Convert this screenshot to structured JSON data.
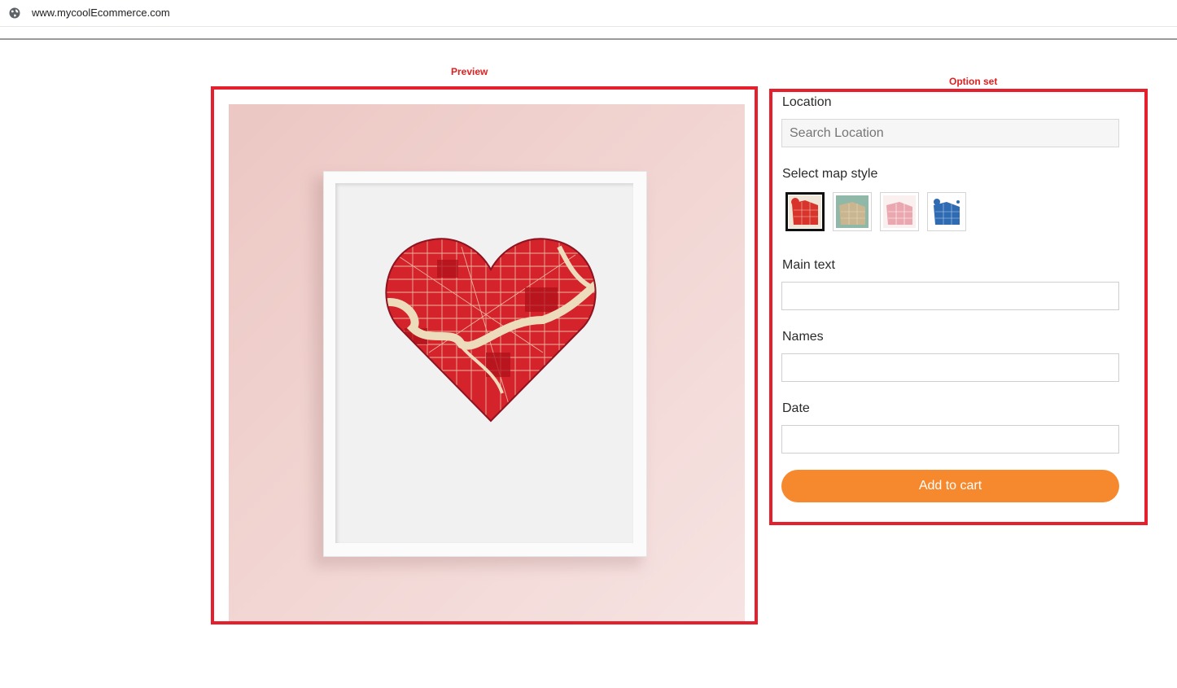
{
  "browser": {
    "url": "www.mycoolEcommerce.com",
    "icon": "globe-icon"
  },
  "annotations": {
    "preview": "Preview",
    "options": "Option set"
  },
  "form": {
    "location_label": "Location",
    "location_placeholder": "Search Location",
    "map_style_label": "Select map style",
    "map_styles": [
      {
        "name": "red",
        "selected": true,
        "color": "#d8342c"
      },
      {
        "name": "teal",
        "selected": false,
        "color": "#7fae9c"
      },
      {
        "name": "pink",
        "selected": false,
        "color": "#e9a2ac"
      },
      {
        "name": "blue",
        "selected": false,
        "color": "#2f6bb3"
      }
    ],
    "main_text_label": "Main text",
    "names_label": "Names",
    "date_label": "Date",
    "add_to_cart": "Add to cart"
  },
  "colors": {
    "accent": "#f6892d",
    "annotation": "#e5202c",
    "map_red": "#d4232a"
  }
}
